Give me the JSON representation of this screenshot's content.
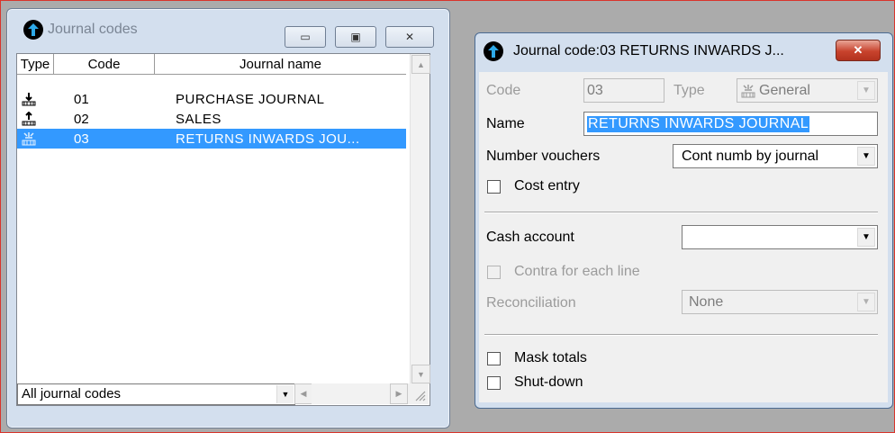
{
  "journal_codes_window": {
    "title": "Journal codes",
    "caption_buttons": {
      "minimize": "▭",
      "maximize": "▣",
      "close": "✕"
    },
    "columns": [
      "Type",
      "Code",
      "Journal name"
    ],
    "rows": [
      {
        "type_icon": "purchase-journal-icon",
        "code": "01",
        "name": "PURCHASE JOURNAL",
        "selected": false
      },
      {
        "type_icon": "sales-journal-icon",
        "code": "02",
        "name": "SALES",
        "selected": false
      },
      {
        "type_icon": "general-journal-icon",
        "code": "03",
        "name": "RETURNS INWARDS JOU...",
        "selected": true
      }
    ],
    "filter_value": "All journal codes"
  },
  "journal_code_window": {
    "title": "Journal code:03 RETURNS INWARDS J...",
    "close_label": "✕",
    "code_label": "Code",
    "code_value": "03",
    "type_label": "Type",
    "type_value": "General",
    "name_label": "Name",
    "name_value": "RETURNS INWARDS JOURNAL",
    "number_vouchers_label": "Number vouchers",
    "number_vouchers_value": "Cont numb by journal",
    "cost_entry_label": "Cost entry",
    "cash_account_label": "Cash account",
    "cash_account_value": "",
    "contra_label": "Contra for each line",
    "reconciliation_label": "Reconciliation",
    "reconciliation_value": "None",
    "mask_totals_label": "Mask totals",
    "shut_down_label": "Shut-down"
  },
  "colors": {
    "selection": "#3399ff",
    "window_frame": "#d3dfee",
    "close_button": "#c8432d"
  }
}
